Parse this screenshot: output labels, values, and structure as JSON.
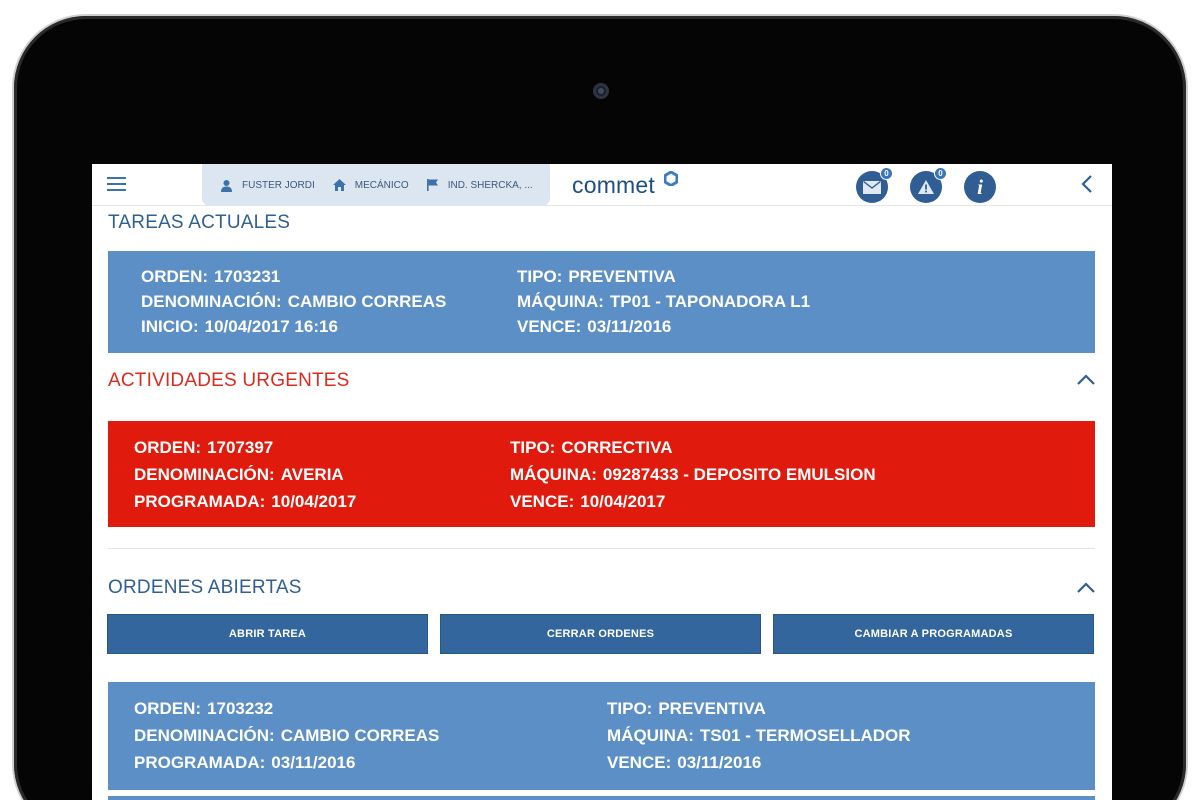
{
  "header": {
    "user": "FUSTER JORDI",
    "role": "MECÁNICO",
    "company": "IND. SHERCKA, ...",
    "logo": "commet",
    "messages_badge": "0",
    "alerts_badge": "0",
    "icons": [
      "menu-icon",
      "user-icon",
      "home-icon",
      "flag-icon",
      "mail-icon",
      "warning-icon",
      "info-icon",
      "chevron-left-icon"
    ]
  },
  "current_tasks": {
    "title": "TAREAS ACTUALES",
    "left": [
      {
        "label": "ORDEN:",
        "value": "1703231"
      },
      {
        "label": "DENOMINACIÓN:",
        "value": "CAMBIO CORREAS"
      },
      {
        "label": "INICIO:",
        "value": "10/04/2017 16:16"
      }
    ],
    "right": [
      {
        "label": "TIPO:",
        "value": "PREVENTIVA"
      },
      {
        "label": "MÁQUINA:",
        "value": "TP01 - TAPONADORA L1"
      },
      {
        "label": "VENCE:",
        "value": "03/11/2016"
      }
    ]
  },
  "urgent": {
    "title": "ACTIVIDADES URGENTES",
    "left": [
      {
        "label": "ORDEN:",
        "value": "1707397"
      },
      {
        "label": "DENOMINACIÓN:",
        "value": "AVERIA"
      },
      {
        "label": "PROGRAMADA:",
        "value": "10/04/2017"
      }
    ],
    "right": [
      {
        "label": "TIPO:",
        "value": "CORRECTIVA"
      },
      {
        "label": "MÁQUINA:",
        "value": "09287433 - DEPOSITO EMULSION"
      },
      {
        "label": "VENCE:",
        "value": "10/04/2017"
      }
    ]
  },
  "open_orders": {
    "title": "ORDENES ABIERTAS",
    "buttons": [
      "ABRIR TAREA",
      "CERRAR ORDENES",
      "CAMBIAR A PROGRAMADAS"
    ],
    "left": [
      {
        "label": "ORDEN:",
        "value": "1703232"
      },
      {
        "label": "DENOMINACIÓN:",
        "value": "CAMBIO CORREAS"
      },
      {
        "label": "PROGRAMADA:",
        "value": "03/11/2016"
      }
    ],
    "right": [
      {
        "label": "TIPO:",
        "value": "PREVENTIVA"
      },
      {
        "label": "MÁQUINA:",
        "value": "TS01 - TERMOSELLADOR"
      },
      {
        "label": "VENCE:",
        "value": "03/11/2016"
      }
    ]
  },
  "colors": {
    "primary": "#2f5f93",
    "card_blue": "#5b8fc6",
    "urgent_red": "#e01b0d",
    "button_blue": "#34669e"
  }
}
